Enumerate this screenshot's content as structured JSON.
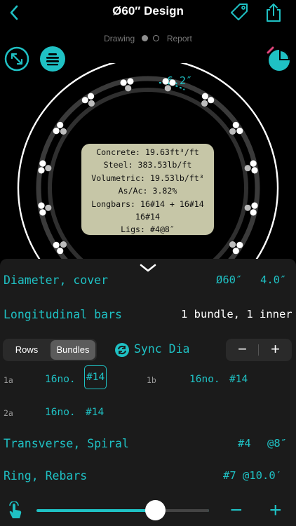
{
  "header": {
    "title": "Ø60″ Design",
    "tabs": [
      "Drawing",
      "Report"
    ],
    "active_tab": "Drawing"
  },
  "drawing": {
    "spacing_label": "6.2″",
    "info": {
      "concrete": "Concrete: 19.63ft³/ft",
      "steel": "Steel: 383.53lb/ft",
      "volumetric": "Volumetric: 19.53lb/ft³",
      "ratio": "As/Ac: 3.82%",
      "longbars": "Longbars: 16#14 + 16#14",
      "longbars_inner": "16#14",
      "ligs": "Ligs: #4@8″"
    }
  },
  "panel": {
    "diameter": {
      "label": "Diameter, cover",
      "dia": "Ø60″",
      "cover": "4.0″"
    },
    "longitudinal": {
      "label": "Longitudinal bars",
      "value": "1 bundle, 1 inner"
    },
    "segmented": {
      "options": [
        "Rows",
        "Bundles"
      ],
      "selected": "Bundles"
    },
    "sync": {
      "label": "Sync Dia"
    },
    "stepper": {
      "minus": "−",
      "plus": "+"
    },
    "bars": [
      {
        "id": "1a",
        "count": "16no.",
        "size": "#14"
      },
      {
        "id": "1b",
        "count": "16no.",
        "size": "#14"
      },
      {
        "id": "2a",
        "count": "16no.",
        "size": "#14"
      }
    ],
    "transverse": {
      "label": "Transverse, Spiral",
      "size": "#4",
      "spacing": "@8″"
    },
    "ring": {
      "label": "Ring, Rebars",
      "value": "#7 @10.0′"
    },
    "zoom": {
      "value": 0.69,
      "minus": "−",
      "plus": "+"
    }
  },
  "colors": {
    "accent": "#1fc1c4",
    "info_bg": "#c6c6a7",
    "sheet_bg": "#1b1b1b"
  }
}
